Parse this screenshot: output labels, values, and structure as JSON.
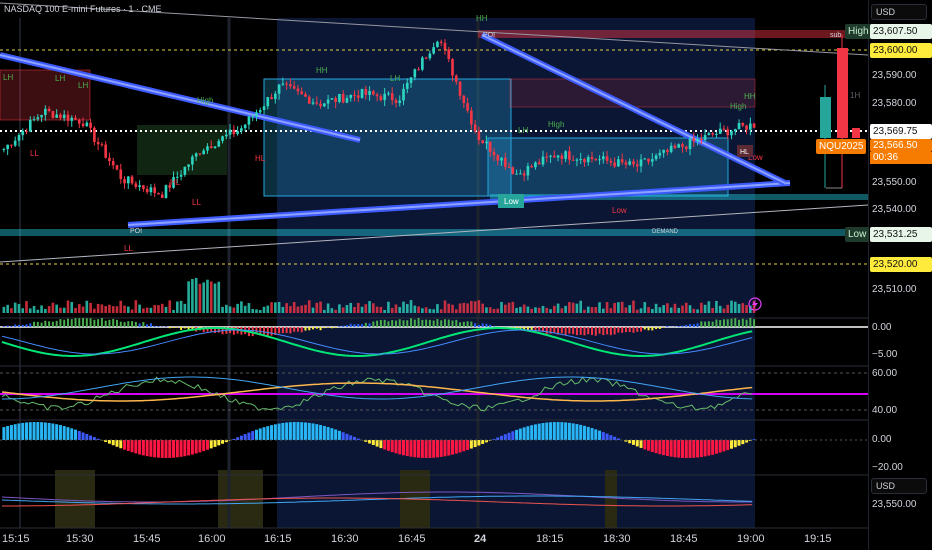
{
  "header": {
    "title": "NASDAQ 100 E-mini Futures · 1 · CME"
  },
  "price_axis": {
    "currency": "USD",
    "labels": [
      "23,590.00",
      "23,580.00",
      "23,550.00",
      "23,540.00",
      "23,510.00"
    ]
  },
  "tags": {
    "high_label": "High",
    "high_value": "23,607.50",
    "level_600": "23,600.00",
    "current_price": "23,569.75",
    "symbol": "NQU2025",
    "symbol_price": "23,566.50",
    "countdown": "00:36",
    "low_label": "Low",
    "low_value": "23,531.25",
    "level_520": "23,520.00"
  },
  "pane_labels": {
    "p1_zero": "0.00",
    "p1_neg5": "−5.00",
    "p2_60": "60.00",
    "p2_40": "40.00",
    "p3_zero": "0.00",
    "p3_neg20": "−20.00",
    "p4_currency": "USD",
    "p4_value": "23,550.00"
  },
  "time_axis": [
    "15:15",
    "15:30",
    "15:45",
    "16:00",
    "16:15",
    "16:30",
    "16:45",
    "24",
    "18:15",
    "18:30",
    "18:45",
    "19:00",
    "19:15"
  ],
  "annotations": {
    "hh": "HH",
    "lh": "LH",
    "ll": "LL",
    "hl": "HL",
    "high": "High",
    "low": "Low",
    "poi": "POI",
    "demand": "DEMAND",
    "h1": "1H",
    "sub": "sub",
    "flag": "Low"
  },
  "colors": {
    "bull": "#2dd4bf",
    "bear": "#f23645",
    "accent": "#2962ff",
    "yellow": "#ffeb3b",
    "green": "#4caf50"
  },
  "chart_data": {
    "type": "candlestick",
    "instrument": "NASDAQ 100 E-mini Futures",
    "interval": "1",
    "exchange": "CME",
    "y_range": [
      23500,
      23612
    ],
    "current": 23569.75,
    "session_high": 23607.5,
    "session_low": 23531.25,
    "key_levels": [
      23600.0,
      23520.0
    ],
    "series_close_approx": [
      23560,
      23575,
      23571,
      23548,
      23542,
      23560,
      23568,
      23585,
      23578,
      23582,
      23580,
      23605,
      23565,
      23550,
      23558,
      23556,
      23553,
      23560,
      23566,
      23569.75
    ]
  }
}
